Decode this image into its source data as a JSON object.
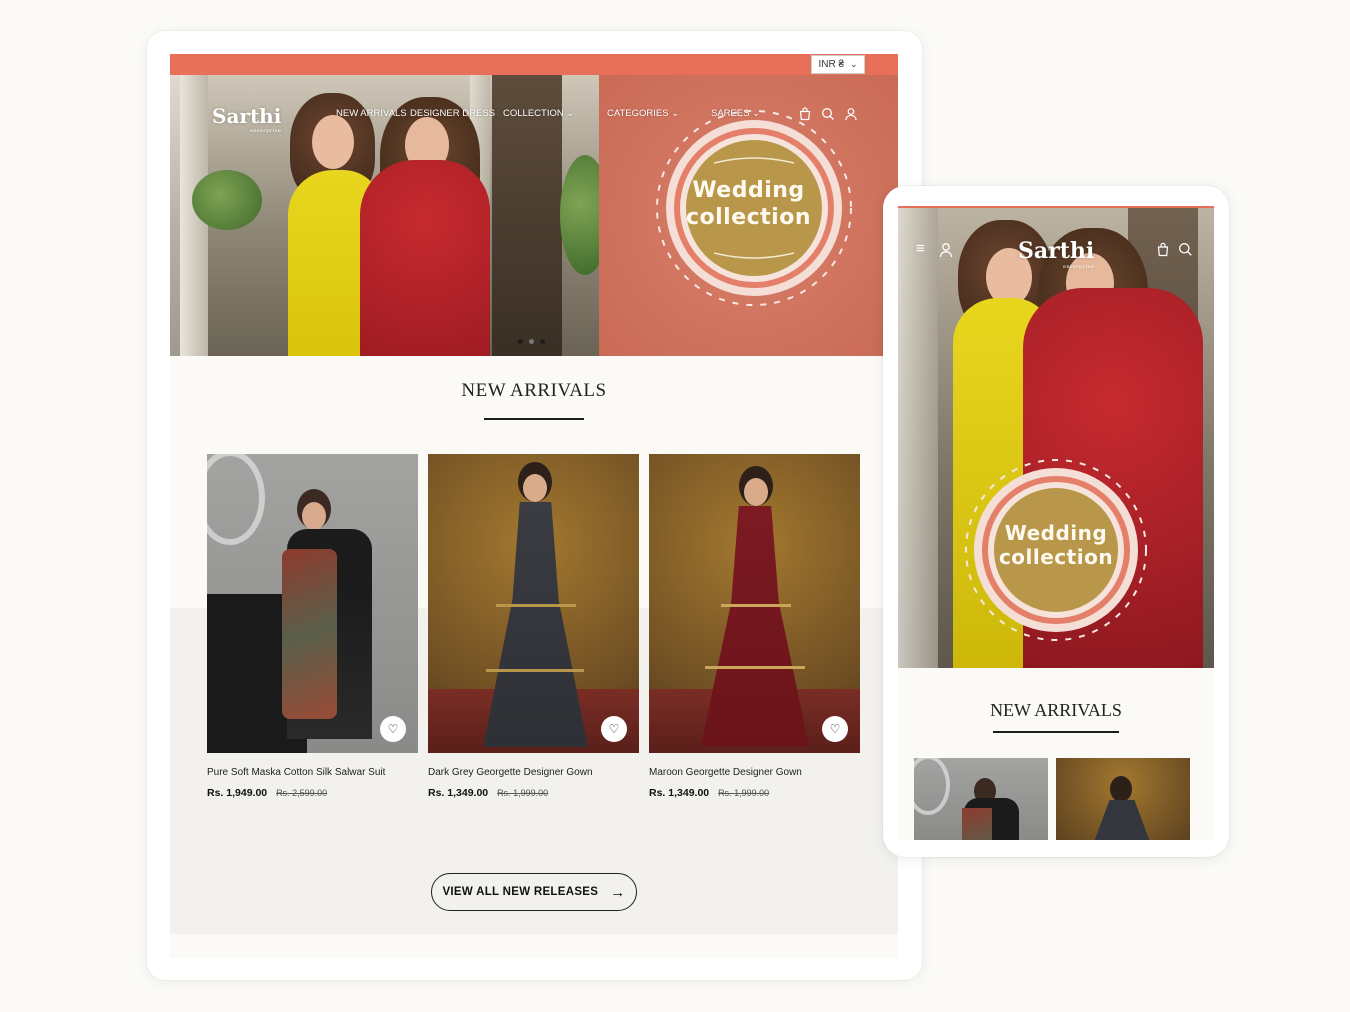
{
  "desktop": {
    "currency": {
      "label": "INR ₴",
      "chevron": "chevron-down-icon"
    },
    "logo": {
      "name": "Sarthi",
      "tagline": "enterprise"
    },
    "nav": [
      {
        "label": "NEW ARRIVALS"
      },
      {
        "label": "DESIGNER DRESS"
      },
      {
        "label": "COLLECTION ⌄"
      },
      {
        "label": "CATEGORIES ⌄"
      },
      {
        "label": "SAREES ⌄"
      }
    ],
    "header_icons": [
      "bag-icon",
      "search-icon",
      "user-icon"
    ],
    "hero": {
      "banner_line1": "Wedding",
      "banner_line2": "collection",
      "slides": 3,
      "active_slide": 3
    },
    "section_title": "NEW ARRIVALS",
    "products": [
      {
        "name": "Pure Soft Maska Cotton Silk Salwar Suit",
        "price": "Rs. 1,949.00",
        "compare_price": "Rs. 2,599.00"
      },
      {
        "name": "Dark Grey Georgette Designer Gown",
        "price": "Rs. 1,349.00",
        "compare_price": "Rs. 1,999.00"
      },
      {
        "name": "Maroon Georgette Designer Gown",
        "price": "Rs. 1,349.00",
        "compare_price": "Rs. 1,999.00"
      }
    ],
    "view_all_label": "VIEW ALL NEW RELEASES"
  },
  "mobile": {
    "logo": {
      "name": "Sarthi",
      "tagline": "enterprise"
    },
    "header_icons": [
      "menu-icon",
      "user-icon",
      "bag-icon",
      "search-icon"
    ],
    "banner_line1": "Wedding",
    "banner_line2": "collection",
    "section_title": "NEW ARRIVALS"
  },
  "colors": {
    "page_bg": "#fbfaf6",
    "accent_coral": "#e86f5a",
    "banner_coral": "#d17862",
    "medallion_gold": "#b9974a",
    "text_dark": "#1d1d1d"
  }
}
